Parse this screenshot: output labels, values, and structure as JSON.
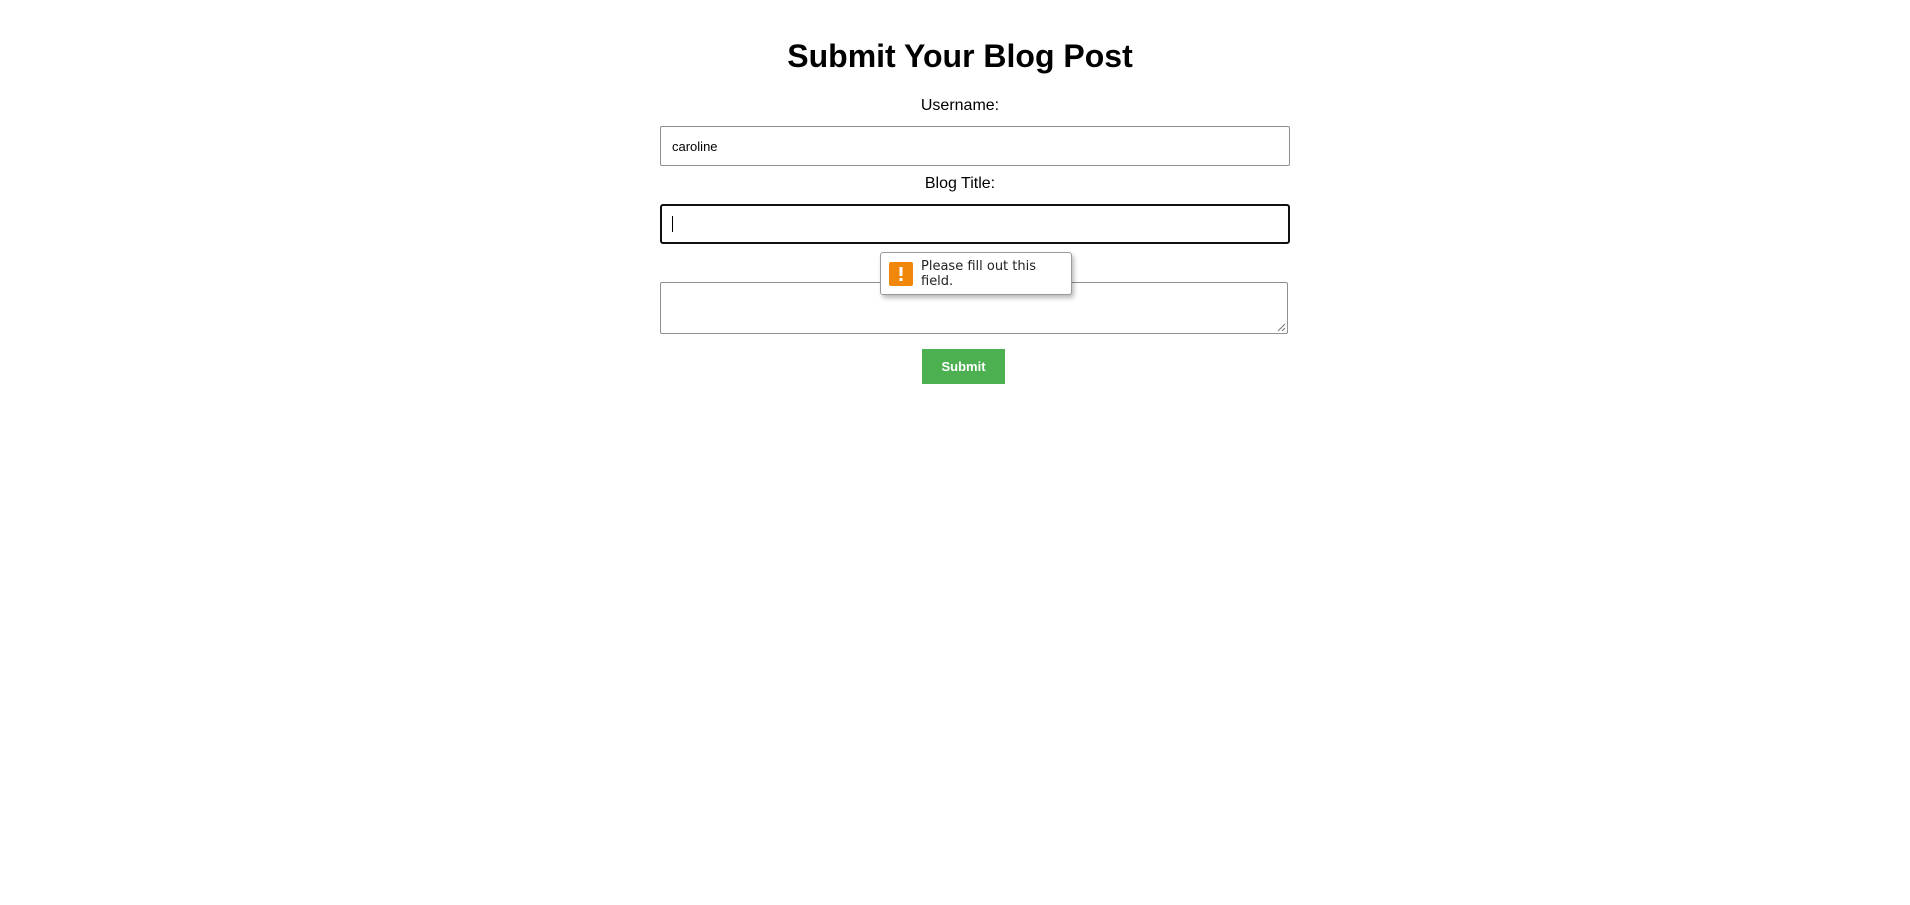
{
  "page": {
    "title": "Submit Your Blog Post"
  },
  "form": {
    "username_label": "Username:",
    "username_value": "caroline",
    "title_label": "Blog Title:",
    "title_value": "",
    "content_value": "",
    "submit_label": "Submit"
  },
  "validation": {
    "message": "Please fill out this field.",
    "icon": "warning-icon"
  },
  "colors": {
    "submit_bg": "#4caf50",
    "warning": "#f0870a"
  }
}
